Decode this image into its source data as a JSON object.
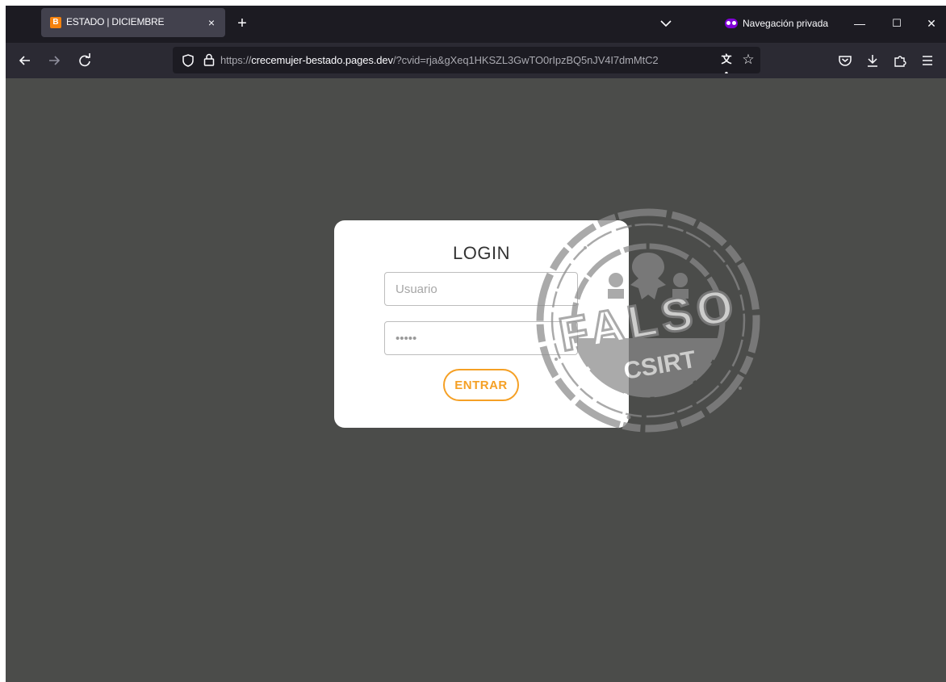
{
  "browser": {
    "tab": {
      "favicon_letter": "B",
      "title": "ESTADO | DICIEMBRE",
      "close_glyph": "×"
    },
    "new_tab_glyph": "+",
    "private_label": "Navegación privada",
    "window_buttons": {
      "minimize": "—",
      "maximize": "☐",
      "close": "✕"
    },
    "url": {
      "scheme": "https://",
      "host": "crecemujer-bestado.pages.dev",
      "rest": "/?cvid=rja&gXeq1HKSZL3GwTO0rIpzBQ5nJV4I7dmMtC2"
    },
    "translate_glyph": "文A"
  },
  "login": {
    "title": "LOGIN",
    "username_placeholder": "Usuario",
    "password_value": "•••••",
    "submit_label": "ENTRAR"
  },
  "stamp": {
    "word": "FALSO",
    "org": "CSIRT"
  },
  "colors": {
    "accent": "#f5a025",
    "page_background": "#4b4c4a",
    "stamp": "#8a8a8a"
  }
}
